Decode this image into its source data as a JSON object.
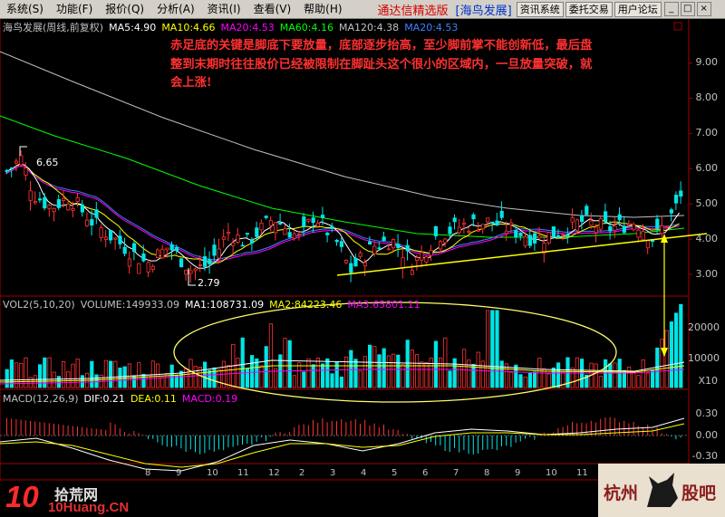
{
  "menubar": {
    "items": [
      "系统(S)",
      "功能(F)",
      "报价(Q)",
      "分析(A)",
      "资讯(I)",
      "查看(V)",
      "帮助(H)"
    ],
    "app_title": "通达信精选版",
    "stock_tag": "[海鸟发展]",
    "buttons": [
      "资讯系统",
      "委托交易",
      "用户论坛"
    ],
    "window_buttons": [
      "_",
      "□",
      "×"
    ]
  },
  "price_panel": {
    "title": "海鸟发展(周线,前复权)",
    "indicators": [
      "MA5:4.90",
      "MA10:4.66",
      "MA20:4.53",
      "MA60:4.16",
      "MA120:4.38",
      "MA20:4.53"
    ],
    "y_ticks": [
      "9.00",
      "8.00",
      "7.00",
      "6.00",
      "5.00",
      "4.00",
      "3.00"
    ],
    "high_label": "6.65",
    "low_label": "2.79"
  },
  "annotation": "赤足底的关键是脚底下要放量，底部逐步抬高，至少脚前掌不能创新低，最后盘整到末期时往往股价已经被限制在脚趾头这个很小的区域内，一旦放量突破，就会上涨!",
  "volume_panel": {
    "title": "VOL2(5,10,20)",
    "values": [
      "VOLUME:149933.09",
      "MA1:108731.09",
      "MA2:84223.46",
      "MA3:65801.11"
    ],
    "y_ticks": [
      "20000",
      "10000"
    ],
    "unit": "X10"
  },
  "macd_panel": {
    "title": "MACD(12,26,9)",
    "values": [
      "DIF:0.21",
      "DEA:0.11",
      "MACD:0.19"
    ],
    "y_ticks": [
      "0.30",
      "0.00",
      "-0.30"
    ]
  },
  "time_axis": [
    "8",
    "9",
    "10",
    "11",
    "12",
    "2",
    "3",
    "4",
    "5",
    "6",
    "7",
    "8",
    "9",
    "10",
    "11",
    "12",
    "2",
    "3"
  ],
  "logo": {
    "num": "10",
    "cn": "拾荒网",
    "en": "10Huang.CN"
  },
  "stamp": {
    "left": "杭州",
    "right": "股吧"
  },
  "colors": {
    "up": "#ff3232",
    "down": "#00e5e5",
    "ma5": "#ffffff",
    "ma10": "#ffff00",
    "ma20": "#ff00ff",
    "ma60": "#00ff00",
    "ma120": "#c0c0c0",
    "ma20b": "#4080ff",
    "trend": "#ffff00",
    "ellipse": "#ffff66"
  }
}
